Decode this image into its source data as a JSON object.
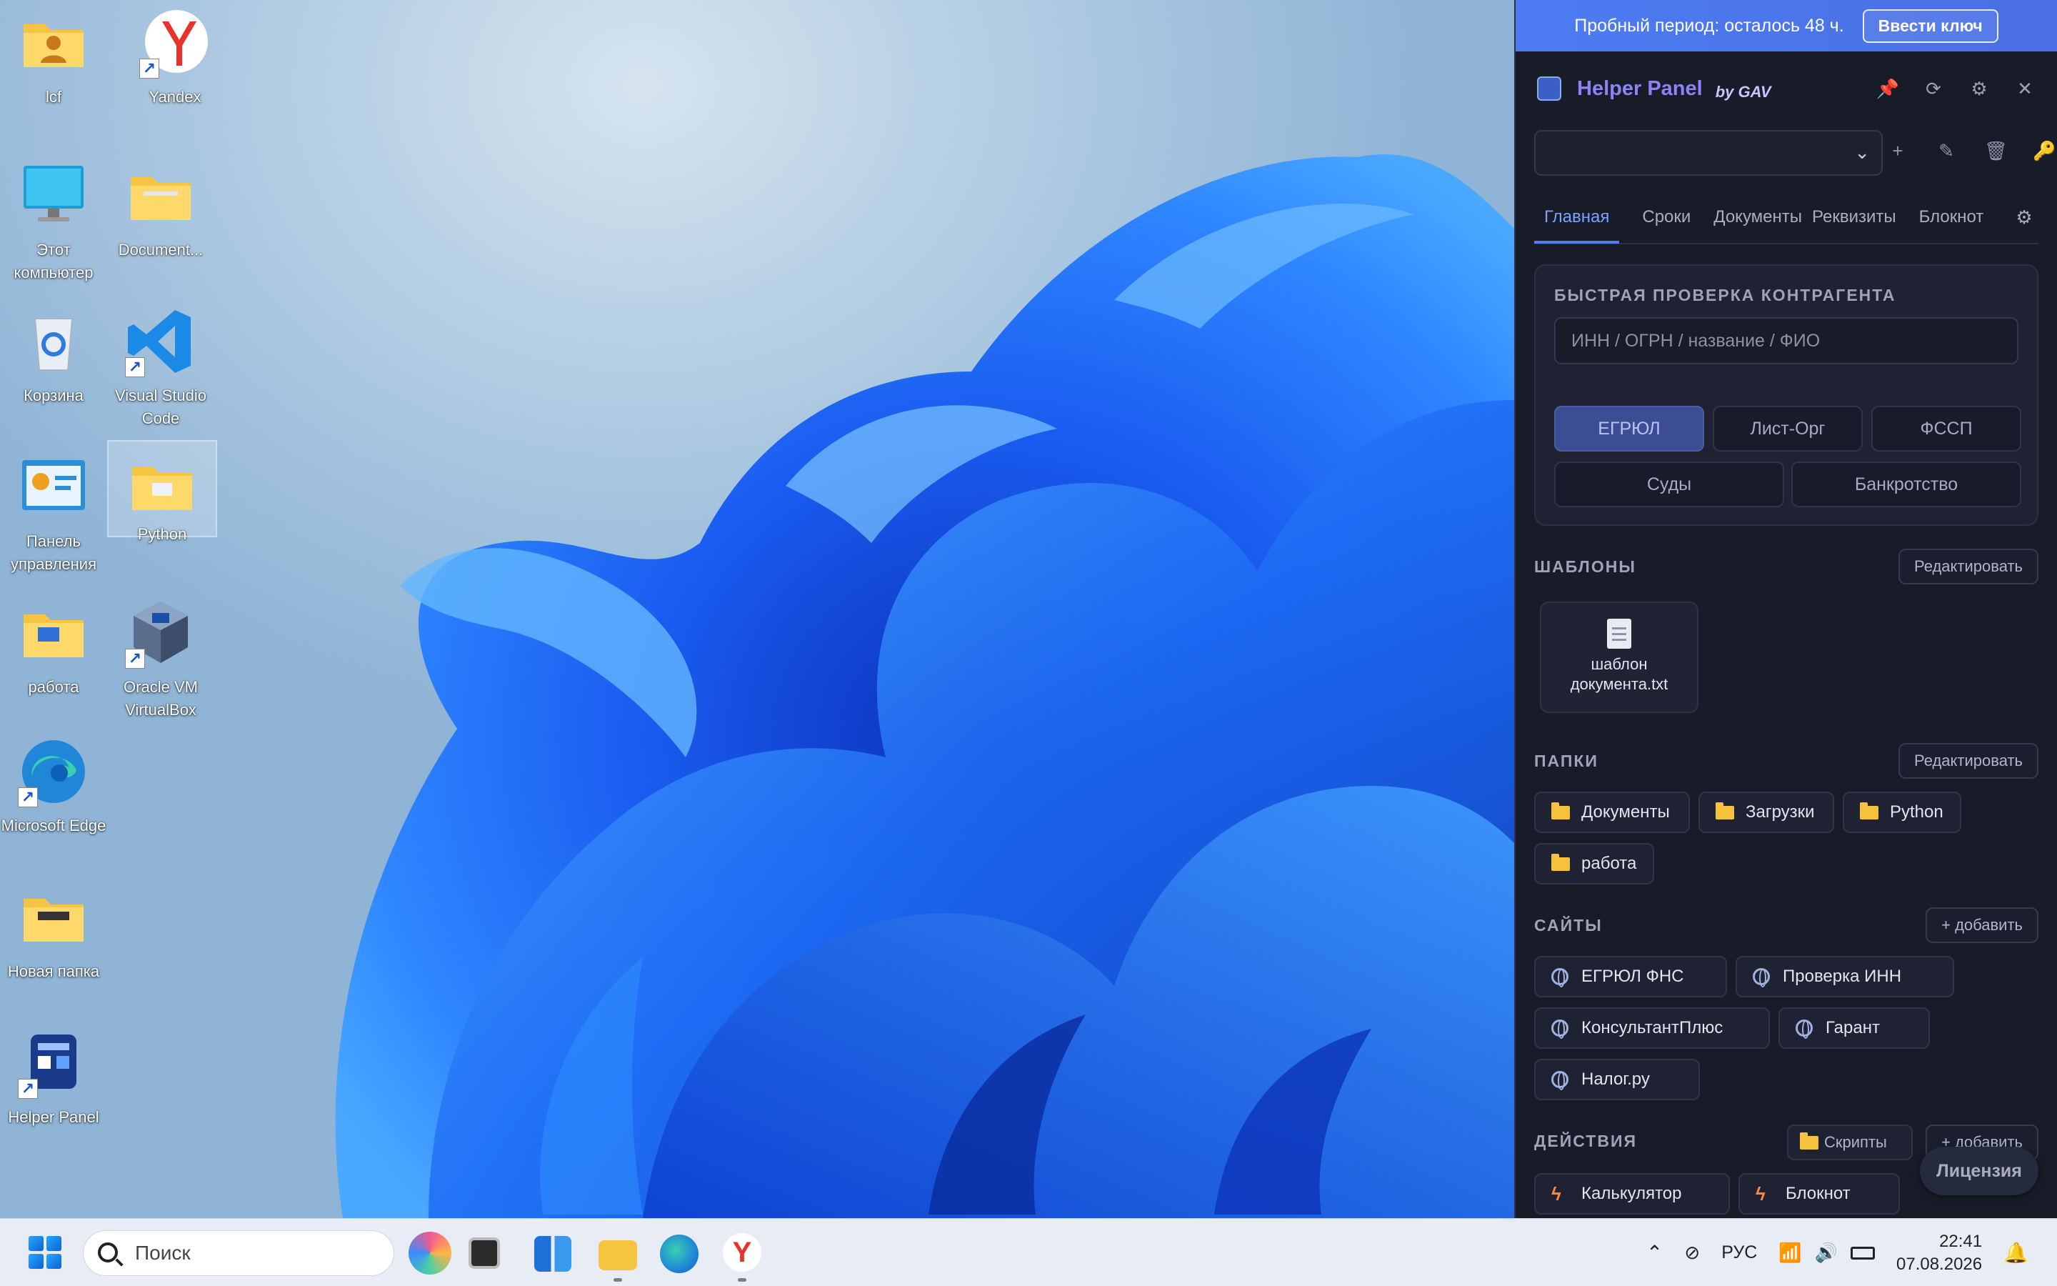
{
  "desktop": {
    "icons": [
      {
        "label": "lcf",
        "icon": "folder-user-icon"
      },
      {
        "label": "Yandex",
        "icon": "yandex-browser-icon"
      },
      {
        "label": "Этот компьютер",
        "icon": "monitor-icon"
      },
      {
        "label": "Document...",
        "icon": "folder-icon"
      },
      {
        "label": "Корзина",
        "icon": "recycle-bin-icon"
      },
      {
        "label": "Visual Studio Code",
        "icon": "vscode-icon"
      },
      {
        "label": "Панель управления",
        "icon": "control-panel-icon"
      },
      {
        "label": "Python",
        "icon": "folder-icon"
      },
      {
        "label": "работа",
        "icon": "folder-icon"
      },
      {
        "label": "Oracle VM VirtualBox",
        "icon": "virtualbox-icon"
      },
      {
        "label": "Microsoft Edge",
        "icon": "edge-icon"
      },
      {
        "label": "Новая папка",
        "icon": "folder-icon"
      },
      {
        "label": "Helper Panel",
        "icon": "helper-panel-icon"
      }
    ]
  },
  "panel": {
    "trial_text": "Пробный период: осталось 48 ч.",
    "trial_button": "Ввести ключ",
    "title": "Helper Panel",
    "subtitle": "by GAV",
    "header_icons": [
      "pin-icon",
      "refresh-icon",
      "gear-icon",
      "close-icon"
    ],
    "profile_icons": [
      "plus-icon",
      "edit-icon",
      "trash-icon",
      "key-icon"
    ],
    "tabs": [
      "Главная",
      "Сроки",
      "Документы",
      "Реквизиты",
      "Блокнот"
    ],
    "active_tab": "Главная",
    "check": {
      "heading": "БЫСТРАЯ ПРОВЕРКА КОНТРАГЕНТА",
      "placeholder": "ИНН / ОГРН / название / ФИО",
      "buttons": [
        "ЕГРЮЛ",
        "Лист-Орг",
        "ФССП",
        "Суды",
        "Банкротство"
      ],
      "active": "ЕГРЮЛ"
    },
    "templates": {
      "heading": "ШАБЛОНЫ",
      "edit": "Редактировать",
      "items": [
        "шаблон документа.txt"
      ]
    },
    "folders": {
      "heading": "ПАПКИ",
      "edit": "Редактировать",
      "items": [
        "Документы",
        "Загрузки",
        "Python",
        "работа"
      ]
    },
    "sites": {
      "heading": "САЙТЫ",
      "add": "+ добавить",
      "items": [
        "ЕГРЮЛ ФНС",
        "Проверка ИНН",
        "КонсультантПлюс",
        "Гарант",
        "Налог.ру"
      ]
    },
    "actions": {
      "heading": "ДЕЙСТВИЯ",
      "scripts": "Скрипты",
      "add": "+ добавить",
      "items": [
        "Калькулятор",
        "Блокнот"
      ]
    },
    "license": "Лицензия"
  },
  "taskbar": {
    "search_placeholder": "Поиск",
    "apps": [
      "copilot-icon",
      "terminal-icon",
      "widgets-icon",
      "explorer-icon",
      "edge-icon",
      "yandex-icon"
    ],
    "lang": "РУС",
    "time": "22:41",
    "date": "07.08.2026"
  }
}
